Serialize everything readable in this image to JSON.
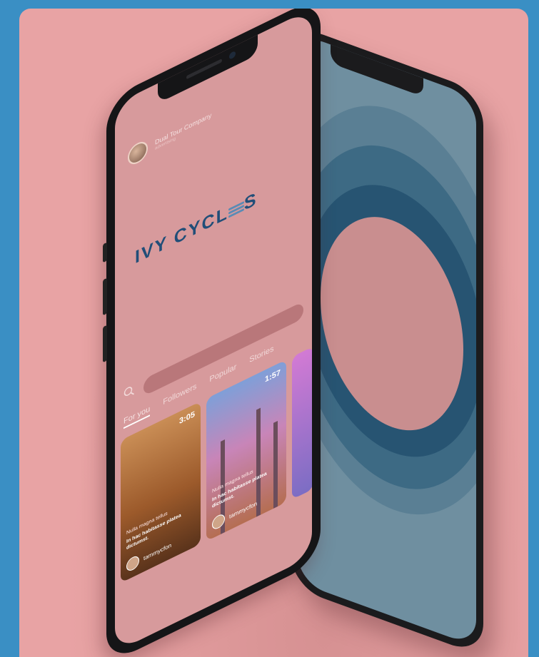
{
  "app": {
    "profile_name": "Dual Tour Company",
    "profile_sub": "advertising",
    "logo_text_left": "IVY CYCL",
    "logo_text_right": "S",
    "tabs": [
      {
        "label": "For you",
        "active": true
      },
      {
        "label": "Followers",
        "active": false
      },
      {
        "label": "Popular",
        "active": false
      },
      {
        "label": "Stories",
        "active": false
      }
    ],
    "cards": [
      {
        "duration": "3:05",
        "tag": "Nulla magna tellus",
        "caption": "In hac habitasse platea dictumst.",
        "user": "tammycfon"
      },
      {
        "duration": "1:57",
        "tag": "Nulla magna tellus",
        "caption": "In hac habitasse platea dictumst.",
        "user": "tammycfon"
      }
    ]
  },
  "colors": {
    "frame_blue": "#3a8fc4",
    "background_pink": "#e8a3a4",
    "logo_navy": "#214e78",
    "ring_dark": "#275472"
  }
}
